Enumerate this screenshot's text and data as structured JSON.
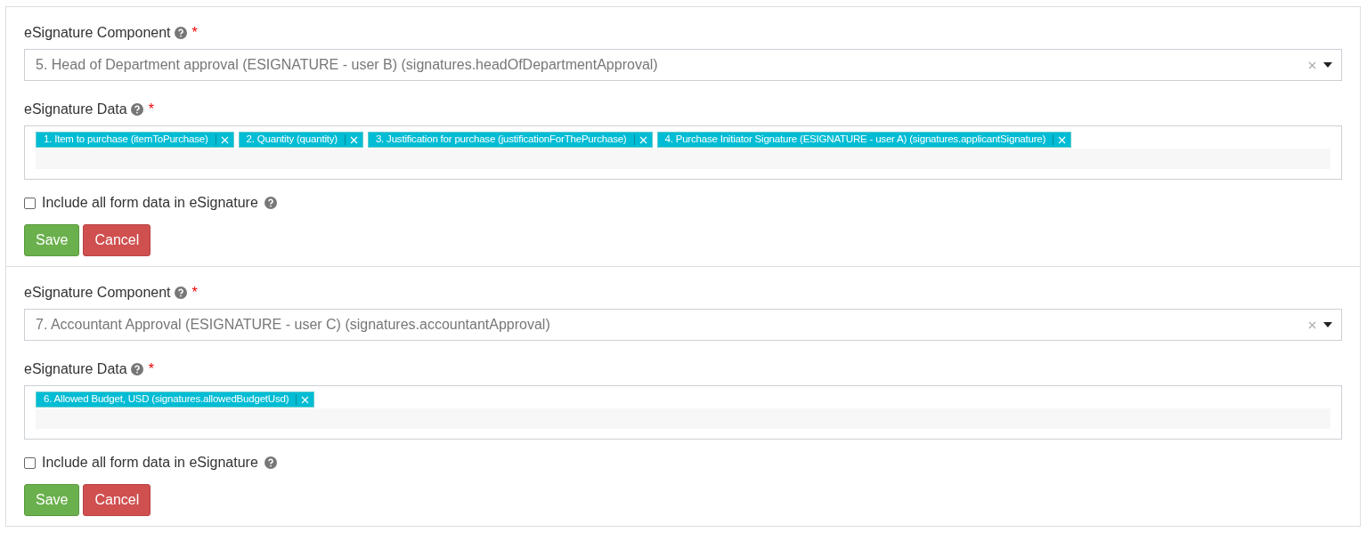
{
  "sections": [
    {
      "component": {
        "label": "eSignature Component",
        "required_mark": "*",
        "value": "5. Head of Department approval (ESIGNATURE - user B) (signatures.headOfDepartmentApproval)"
      },
      "data": {
        "label": "eSignature Data",
        "required_mark": "*",
        "tags": [
          "1. Item to purchase (itemToPurchase)",
          "2. Quantity (quantity)",
          "3. Justification for purchase (justificationForThePurchase)",
          "4. Purchase Initiator Signature (ESIGNATURE - user A) (signatures.applicantSignature)"
        ]
      },
      "include_all": {
        "label": "Include all form data in eSignature",
        "checked": false
      },
      "buttons": [
        {
          "label": "Save",
          "kind": "save"
        },
        {
          "label": "Cancel",
          "kind": "cancel"
        }
      ]
    },
    {
      "component": {
        "label": "eSignature Component",
        "required_mark": "*",
        "value": "7. Accountant Approval (ESIGNATURE - user C) (signatures.accountantApproval)"
      },
      "data": {
        "label": "eSignature Data",
        "required_mark": "*",
        "tags": [
          "6. Allowed Budget, USD (signatures.allowedBudgetUsd)"
        ]
      },
      "include_all": {
        "label": "Include all form data in eSignature",
        "checked": false
      },
      "buttons": [
        {
          "label": "Save",
          "kind": "save"
        },
        {
          "label": "Cancel",
          "kind": "cancel"
        }
      ]
    }
  ]
}
